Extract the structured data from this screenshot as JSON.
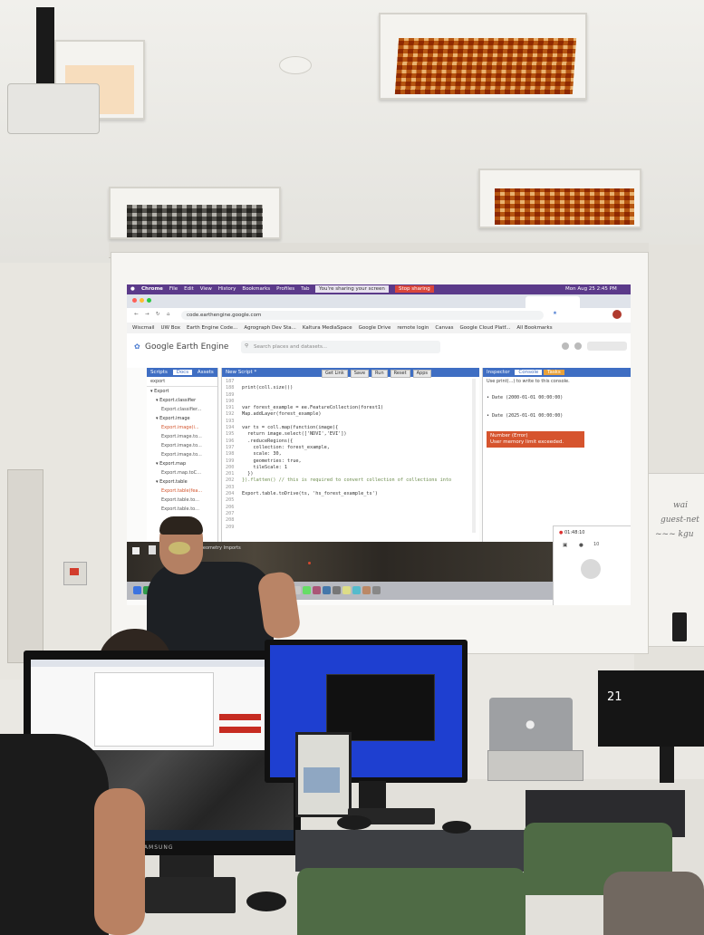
{
  "projection": {
    "mac_menubar": {
      "apple": "",
      "items": [
        "Chrome",
        "File",
        "Edit",
        "View",
        "History",
        "Bookmarks",
        "Profiles",
        "Tab",
        "Window",
        "Help"
      ],
      "sharing_notice": "You're sharing your screen",
      "stop_sharing": "Stop sharing",
      "clock": "Mon Aug 25 2:45 PM"
    },
    "browser": {
      "url": "code.earthengine.google.com",
      "bookmarks": [
        "Wiscmail",
        "UW Box",
        "Earth Engine Code...",
        "Agrograph Dev Sta...",
        "Kaltura MediaSpace",
        "Google Drive",
        "remote login",
        "Canvas",
        "Google Cloud Platf...",
        "All Bookmarks"
      ]
    },
    "gee": {
      "title": "Google Earth Engine",
      "search_placeholder": "Search places and datasets...",
      "left_tabs": [
        "Scripts",
        "Docs",
        "Assets"
      ],
      "filter_text": "export",
      "tree": [
        {
          "label": "▾ Export",
          "indent": 0,
          "color": "#333"
        },
        {
          "label": "▾ Export.classifier",
          "indent": 1,
          "color": "#333"
        },
        {
          "label": "Export.classifier...",
          "indent": 2,
          "color": "#555"
        },
        {
          "label": "▾ Export.image",
          "indent": 1,
          "color": "#333"
        },
        {
          "label": "Export.image(i...",
          "indent": 2,
          "color": "#d3542d"
        },
        {
          "label": "Export.image.to...",
          "indent": 2,
          "color": "#555"
        },
        {
          "label": "Export.image.to...",
          "indent": 2,
          "color": "#555"
        },
        {
          "label": "Export.image.to...",
          "indent": 2,
          "color": "#555"
        },
        {
          "label": "▾ Export.map",
          "indent": 1,
          "color": "#333"
        },
        {
          "label": "Export.map.toC...",
          "indent": 2,
          "color": "#555"
        },
        {
          "label": "▾ Export.table",
          "indent": 1,
          "color": "#333"
        },
        {
          "label": "Export.table(fea...",
          "indent": 2,
          "color": "#d3542d"
        },
        {
          "label": "Export.table.to...",
          "indent": 2,
          "color": "#555"
        },
        {
          "label": "Export.table.to...",
          "indent": 2,
          "color": "#555"
        }
      ],
      "script_title": "New Script *",
      "editor_buttons": [
        "Get Link",
        "Save",
        "Run",
        "Reset",
        "Apps"
      ],
      "code_lines": [
        {
          "n": "187",
          "t": ""
        },
        {
          "n": "188",
          "t": "print(coll.size())"
        },
        {
          "n": "189",
          "t": ""
        },
        {
          "n": "190",
          "t": ""
        },
        {
          "n": "191",
          "t": "var forest_example = ee.FeatureCollection(forest1)"
        },
        {
          "n": "192",
          "t": "Map.addLayer(forest_example)"
        },
        {
          "n": "193",
          "t": ""
        },
        {
          "n": "194",
          "t": "var ts = coll.map(function(image){"
        },
        {
          "n": "195",
          "t": "  return image.select(['NDVI','EVI'])"
        },
        {
          "n": "196",
          "t": "  .reduceRegions({"
        },
        {
          "n": "197",
          "t": "    collection: forest_example,"
        },
        {
          "n": "198",
          "t": "    scale: 30,"
        },
        {
          "n": "199",
          "t": "    geometries: true,"
        },
        {
          "n": "200",
          "t": "    tileScale: 1"
        },
        {
          "n": "201",
          "t": "  })"
        },
        {
          "n": "202",
          "t": "}).flatten() // this is required to convert collection of collections into"
        },
        {
          "n": "203",
          "t": ""
        },
        {
          "n": "204",
          "t": "Export.table.toDrive(ts, 'hs_forest_example_ts')"
        },
        {
          "n": "205",
          "t": ""
        },
        {
          "n": "206",
          "t": ""
        },
        {
          "n": "207",
          "t": ""
        },
        {
          "n": "208",
          "t": ""
        },
        {
          "n": "209",
          "t": ""
        }
      ],
      "console_tabs": [
        "Inspector",
        "Console",
        "Tasks"
      ],
      "console_hint": "Use print(...) to write to this console.",
      "console_dates": [
        "• Date (2000-01-01 00:00:00)",
        "• Date (2025-01-01 00:00:00)"
      ],
      "error_title": "Number (Error)",
      "error_message": "User memory limit exceeded.",
      "layers_label": "Geometry Imports",
      "call_time": "01:48:10",
      "participants": "10"
    }
  },
  "whiteboard": {
    "lines": [
      "wai",
      "guest-net",
      "~~~ kgu"
    ]
  },
  "room": {
    "monitor_brand": "SAMSUNG",
    "right_monitor_text": "21"
  },
  "colors": {
    "gee_blue": "#4a7bd0",
    "error_orange": "#d6542e",
    "mac_menubar_purple": "#5b3a8a",
    "terminal_desktop_blue": "#1e3fd0"
  }
}
